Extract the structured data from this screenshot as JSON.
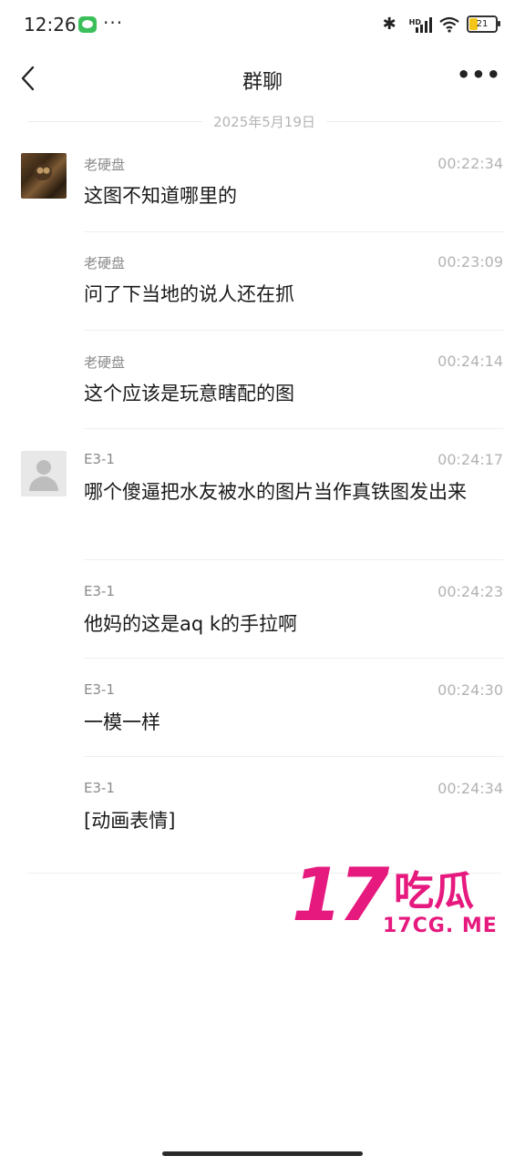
{
  "status_bar": {
    "time": "12:26",
    "dots": "···",
    "hd": "HD",
    "battery": "21"
  },
  "header": {
    "back_glyph": "<",
    "title": "群聊",
    "more_glyph": "•••"
  },
  "date_separator": "2025年5月19日",
  "messages": [
    {
      "sender": "老硬盘",
      "time": "00:22:34",
      "text": "这图不知道哪里的",
      "avatar": "cat-photo"
    },
    {
      "sender": "老硬盘",
      "time": "00:23:09",
      "text": "问了下当地的说人还在抓"
    },
    {
      "sender": "老硬盘",
      "time": "00:24:14",
      "text": "这个应该是玩意瞎配的图"
    },
    {
      "sender": "E3-1",
      "time": "00:24:17",
      "text": "哪个傻逼把水友被水的图片当作真铁图发出来",
      "avatar": "default-user"
    },
    {
      "sender": "E3-1",
      "time": "00:24:23",
      "text": "他妈的这是aq k的手拉啊"
    },
    {
      "sender": "E3-1",
      "time": "00:24:30",
      "text": "一模一样"
    },
    {
      "sender": "E3-1",
      "time": "00:24:34",
      "text": "[动画表情]"
    }
  ],
  "watermark": {
    "big": "17",
    "cn": "吃瓜",
    "url": "17CG. ME"
  },
  "colors": {
    "watermark": "#e6197e",
    "background": "#ffffff"
  }
}
